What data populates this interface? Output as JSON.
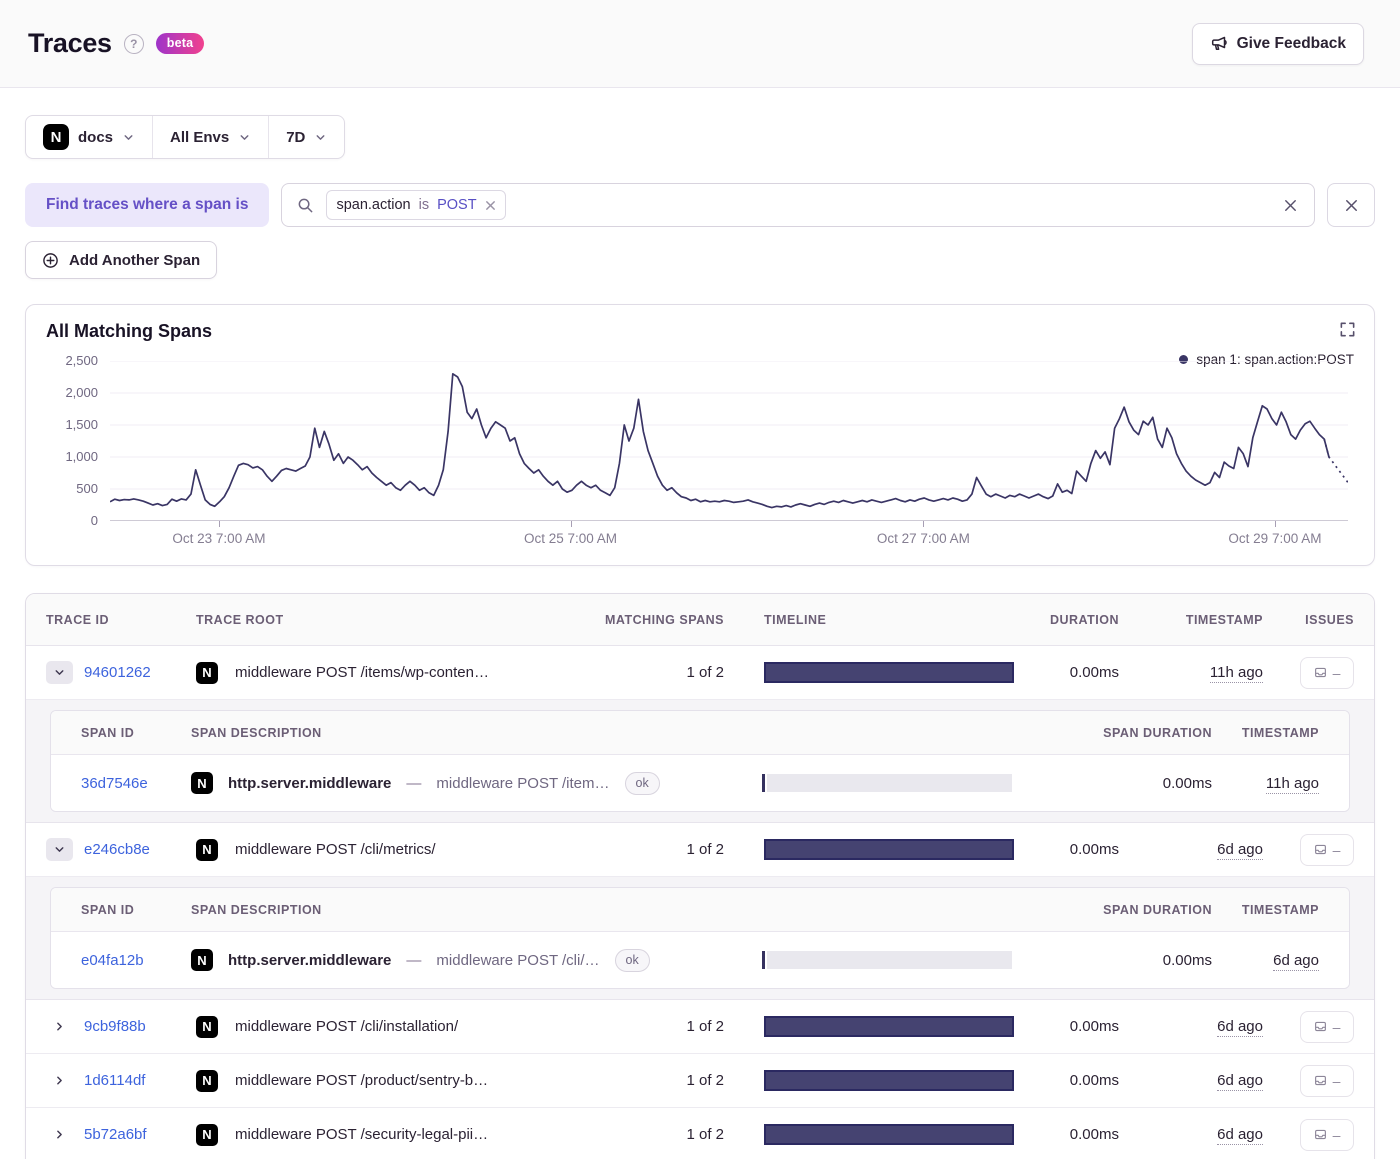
{
  "header": {
    "title": "Traces",
    "beta": "beta",
    "feedback": "Give Feedback"
  },
  "filters": {
    "project": "docs",
    "project_logo": "N",
    "environment": "All Envs",
    "period": "7D"
  },
  "search": {
    "condition_label": "Find traces where a span is",
    "token": {
      "key": "span.action",
      "operator": "is",
      "value": "POST"
    },
    "add_span": "Add Another Span"
  },
  "chart": {
    "title": "All Matching Spans",
    "legend": "span 1: span.action:POST"
  },
  "chart_data": {
    "type": "line",
    "title": "All Matching Spans",
    "xlabel": "",
    "ylabel": "",
    "ylim": [
      0,
      2500
    ],
    "y_ticks": [
      "0",
      "500",
      "1,000",
      "1,500",
      "2,000",
      "2,500"
    ],
    "x_ticks": [
      {
        "label": "Oct 23 7:00 AM",
        "pos": 0.088
      },
      {
        "label": "Oct 25 7:00 AM",
        "pos": 0.372
      },
      {
        "label": "Oct 27 7:00 AM",
        "pos": 0.657
      },
      {
        "label": "Oct 29 7:00 AM",
        "pos": 0.941
      }
    ],
    "grid": "horizontal",
    "legend_position": "top-right",
    "line_color": "#3a3565",
    "dashed_tail_points": 5,
    "series": [
      {
        "name": "span 1: span.action:POST",
        "values": [
          300,
          340,
          320,
          335,
          330,
          345,
          330,
          310,
          280,
          250,
          270,
          240,
          260,
          340,
          310,
          345,
          330,
          420,
          800,
          560,
          330,
          260,
          230,
          300,
          380,
          520,
          700,
          870,
          900,
          880,
          830,
          850,
          800,
          700,
          620,
          700,
          790,
          820,
          800,
          780,
          820,
          860,
          1000,
          1450,
          1150,
          1400,
          1200,
          950,
          1050,
          900,
          1000,
          950,
          880,
          800,
          850,
          750,
          680,
          620,
          560,
          600,
          520,
          480,
          560,
          620,
          560,
          480,
          520,
          440,
          400,
          560,
          800,
          1400,
          2300,
          2250,
          2100,
          1700,
          1600,
          1750,
          1500,
          1300,
          1450,
          1550,
          1500,
          1450,
          1250,
          1300,
          1050,
          900,
          820,
          750,
          800,
          700,
          620,
          560,
          620,
          500,
          450,
          480,
          560,
          620,
          560,
          520,
          560,
          480,
          440,
          400,
          520,
          900,
          1500,
          1250,
          1450,
          1900,
          1400,
          1100,
          900,
          700,
          560,
          480,
          520,
          440,
          380,
          360,
          320,
          340,
          300,
          320,
          300,
          310,
          300,
          320,
          310,
          290,
          300,
          310,
          330,
          300,
          280,
          260,
          230,
          210,
          230,
          220,
          240,
          220,
          250,
          270,
          250,
          230,
          260,
          280,
          260,
          290,
          310,
          290,
          320,
          300,
          280,
          300,
          320,
          300,
          330,
          310,
          290,
          310,
          330,
          350,
          320,
          300,
          330,
          310,
          340,
          360,
          330,
          310,
          330,
          350,
          330,
          360,
          340,
          310,
          330,
          420,
          680,
          550,
          420,
          380,
          420,
          390,
          360,
          400,
          380,
          420,
          390,
          360,
          390,
          420,
          380,
          350,
          390,
          580,
          450,
          480,
          430,
          780,
          700,
          620,
          900,
          1100,
          980,
          1080,
          880,
          1450,
          1600,
          1780,
          1550,
          1420,
          1350,
          1560,
          1500,
          1620,
          1280,
          1150,
          1450,
          1300,
          1050,
          900,
          780,
          700,
          640,
          600,
          560,
          600,
          760,
          680,
          920,
          860,
          820,
          1150,
          1050,
          850,
          1300,
          1550,
          1800,
          1750,
          1600,
          1500,
          1700,
          1550,
          1350,
          1280,
          1420,
          1520,
          1560,
          1450,
          1350,
          1280,
          1000,
          900,
          800,
          700,
          600
        ]
      }
    ]
  },
  "table": {
    "columns": {
      "trace_id": "TRACE ID",
      "trace_root": "TRACE ROOT",
      "matching_spans": "MATCHING SPANS",
      "timeline": "TIMELINE",
      "duration": "DURATION",
      "timestamp": "TIMESTAMP",
      "issues": "ISSUES"
    },
    "sub_columns": {
      "span_id": "SPAN ID",
      "span_description": "SPAN DESCRIPTION",
      "span_duration": "SPAN DURATION",
      "timestamp": "TIMESTAMP"
    },
    "span_separator": "—",
    "issues_placeholder": "–",
    "rows": [
      {
        "trace_id": "94601262",
        "expanded": true,
        "trace_root": "middleware POST /items/wp-conten…",
        "matching_spans": "1 of 2",
        "duration": "0.00ms",
        "timestamp": "11h ago",
        "spans": [
          {
            "span_id": "36d7546e",
            "op": "http.server.middleware",
            "description": "middleware POST /item…",
            "status": "ok",
            "span_duration": "0.00ms",
            "timestamp": "11h ago"
          }
        ]
      },
      {
        "trace_id": "e246cb8e",
        "expanded": true,
        "trace_root": "middleware POST /cli/metrics/",
        "matching_spans": "1 of 2",
        "duration": "0.00ms",
        "timestamp": "6d ago",
        "spans": [
          {
            "span_id": "e04fa12b",
            "op": "http.server.middleware",
            "description": "middleware POST /cli/…",
            "status": "ok",
            "span_duration": "0.00ms",
            "timestamp": "6d ago"
          }
        ]
      },
      {
        "trace_id": "9cb9f88b",
        "expanded": false,
        "trace_root": "middleware POST /cli/installation/",
        "matching_spans": "1 of 2",
        "duration": "0.00ms",
        "timestamp": "6d ago",
        "spans": []
      },
      {
        "trace_id": "1d6114df",
        "expanded": false,
        "trace_root": "middleware POST /product/sentry-b…",
        "matching_spans": "1 of 2",
        "duration": "0.00ms",
        "timestamp": "6d ago",
        "spans": []
      },
      {
        "trace_id": "5b72a6bf",
        "expanded": false,
        "trace_root": "middleware POST /security-legal-pii…",
        "matching_spans": "1 of 2",
        "duration": "0.00ms",
        "timestamp": "6d ago",
        "spans": []
      }
    ]
  },
  "colors": {
    "accent_purple": "#6550c6",
    "link_blue": "#3d63dd",
    "chart_line": "#3a3565",
    "timeline_bar": "#454371",
    "beta_gradient_from": "#9e34c9",
    "beta_gradient_to": "#f1418e",
    "token_value": "#584fc4"
  }
}
